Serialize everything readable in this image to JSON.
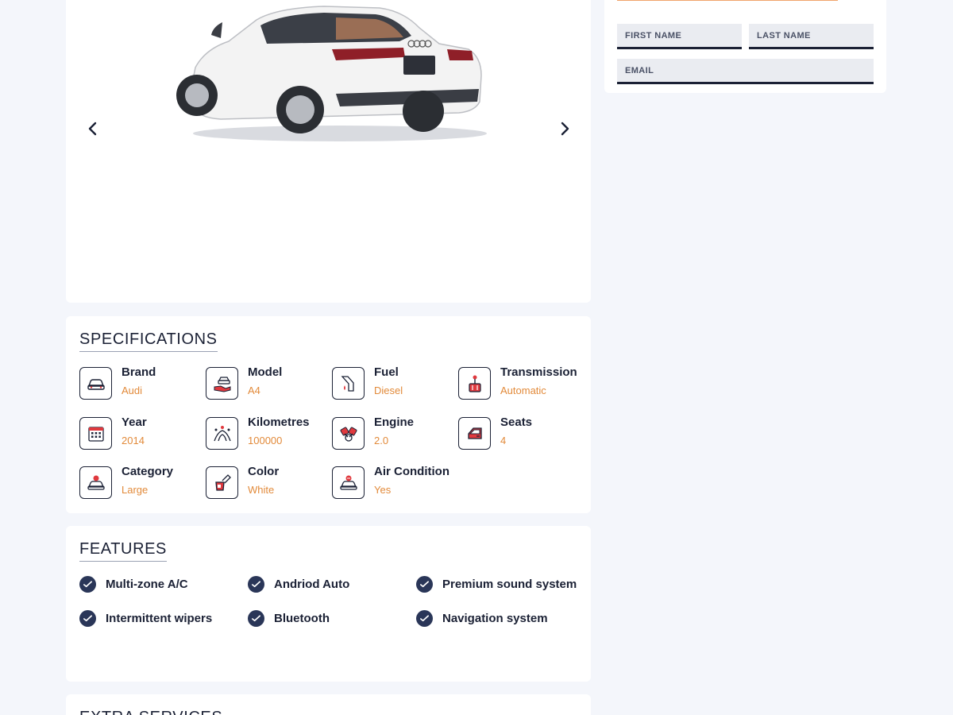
{
  "gallery": {
    "image_alt": "white-audi-a4-sedan",
    "prev_icon": "chevron-left-icon",
    "next_icon": "chevron-right-icon"
  },
  "contact_form": {
    "first_name_placeholder": "FIRST NAME",
    "last_name_placeholder": "LAST NAME",
    "email_placeholder": "EMAIL",
    "accent_color": "#f0a36b"
  },
  "specifications": {
    "title": "SPECIFICATIONS",
    "items": [
      {
        "label": "Brand",
        "value": "Audi",
        "icon": "car-icon"
      },
      {
        "label": "Model",
        "value": "A4",
        "icon": "car-hand-icon"
      },
      {
        "label": "Fuel",
        "value": "Diesel",
        "icon": "fuel-nozzle-icon"
      },
      {
        "label": "Transmission",
        "value": "Automatic",
        "icon": "gear-shift-icon"
      },
      {
        "label": "Year",
        "value": "2014",
        "icon": "calendar-icon"
      },
      {
        "label": "Kilometres",
        "value": "100000",
        "icon": "road-icon"
      },
      {
        "label": "Engine",
        "value": "2.0",
        "icon": "engine-piston-icon"
      },
      {
        "label": "Seats",
        "value": "4",
        "icon": "car-door-icon"
      },
      {
        "label": "Category",
        "value": "Large",
        "icon": "car-category-icon"
      },
      {
        "label": "Color",
        "value": "White",
        "icon": "paint-bucket-icon"
      },
      {
        "label": "Air Condition",
        "value": "Yes",
        "icon": "car-ac-icon"
      }
    ],
    "value_color": "#e28a3a"
  },
  "features": {
    "title": "FEATURES",
    "items": [
      {
        "label": "Multi-zone A/C"
      },
      {
        "label": "Andriod Auto"
      },
      {
        "label": "Premium sound system"
      },
      {
        "label": "Intermittent wipers"
      },
      {
        "label": "Bluetooth"
      },
      {
        "label": "Navigation system"
      }
    ],
    "check_color": "#2a3658"
  },
  "extra_services": {
    "title": "EXTRA SERVICES"
  }
}
